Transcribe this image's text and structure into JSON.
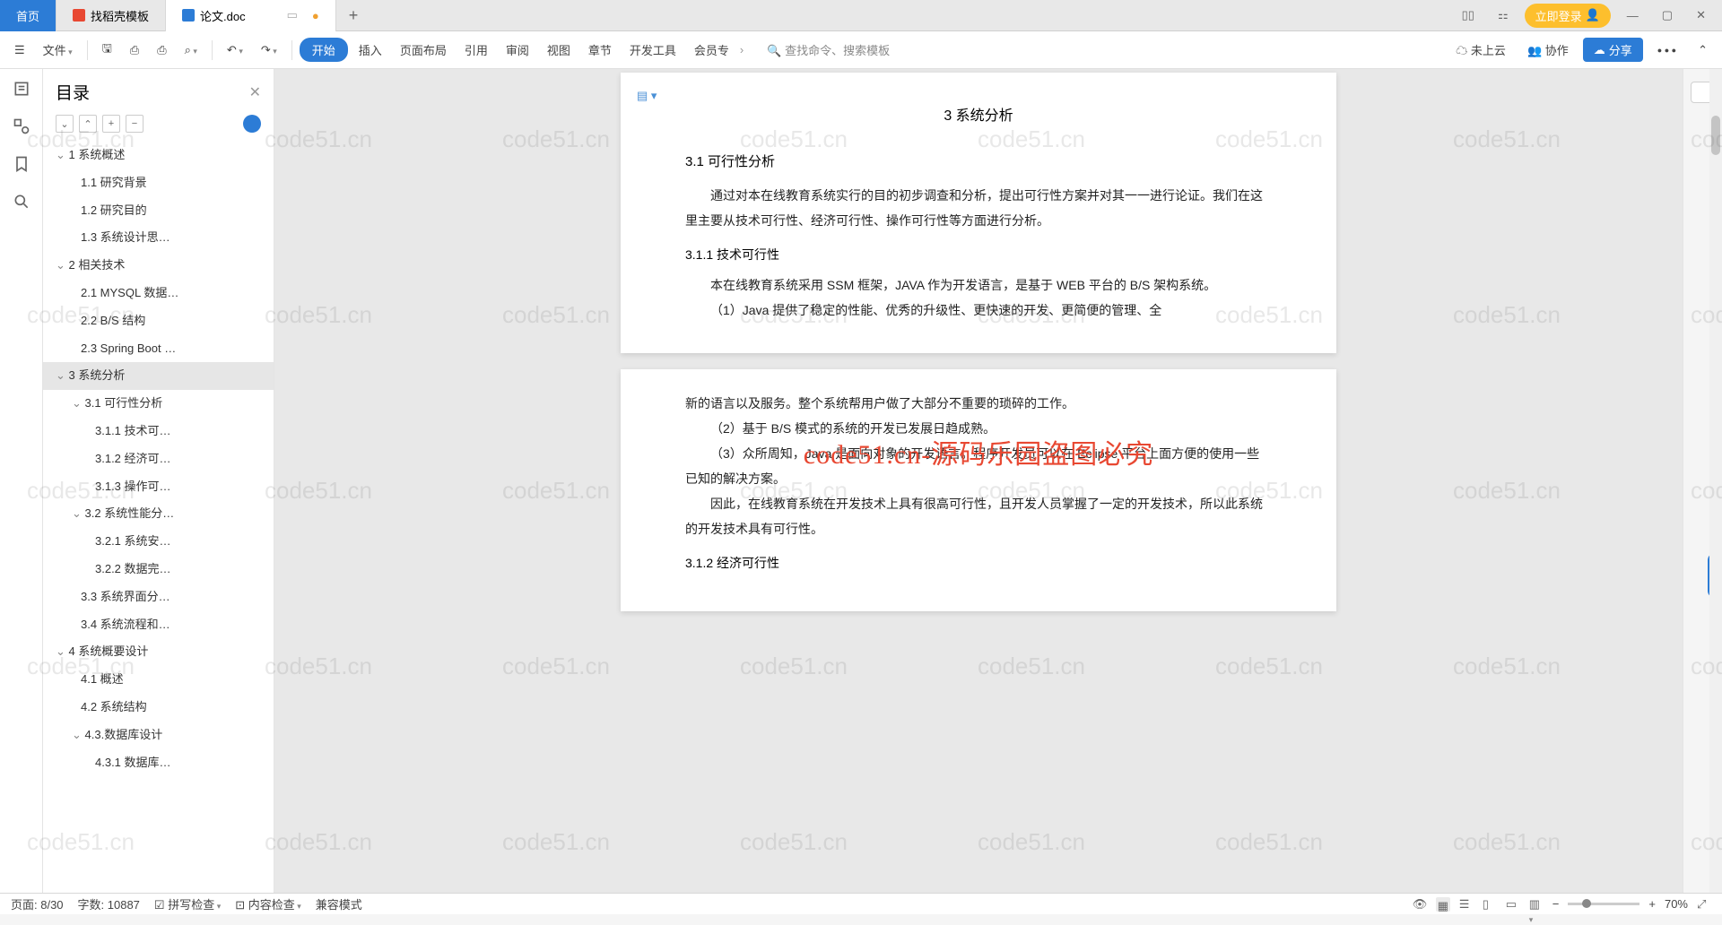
{
  "tabs": {
    "home": "首页",
    "template": "找稻壳模板",
    "doc": "论文.doc"
  },
  "titlebar": {
    "login": "立即登录"
  },
  "ribbon": {
    "menu": "文件",
    "start": "开始",
    "insert": "插入",
    "layout": "页面布局",
    "ref": "引用",
    "review": "审阅",
    "view": "视图",
    "chapter": "章节",
    "devtools": "开发工具",
    "member": "会员专",
    "search_ph": "查找命令、搜索模板",
    "cloud": "未上云",
    "collab": "协作",
    "share": "分享"
  },
  "outline": {
    "title": "目录",
    "items": [
      {
        "t": "1 系统概述",
        "c": "l1"
      },
      {
        "t": "1.1 研究背景",
        "c": "l2"
      },
      {
        "t": "1.2 研究目的",
        "c": "l2"
      },
      {
        "t": "1.3 系统设计思…",
        "c": "l2"
      },
      {
        "t": "2 相关技术",
        "c": "l1"
      },
      {
        "t": "2.1 MYSQL 数据…",
        "c": "l2"
      },
      {
        "t": "2.2 B/S 结构",
        "c": "l2"
      },
      {
        "t": "2.3 Spring Boot …",
        "c": "l2"
      },
      {
        "t": "3 系统分析",
        "c": "l1 sel"
      },
      {
        "t": "3.1 可行性分析",
        "c": "l2s"
      },
      {
        "t": "3.1.1 技术可…",
        "c": "l3"
      },
      {
        "t": "3.1.2 经济可…",
        "c": "l3"
      },
      {
        "t": "3.1.3 操作可…",
        "c": "l3"
      },
      {
        "t": "3.2 系统性能分…",
        "c": "l2s"
      },
      {
        "t": "3.2.1 系统安…",
        "c": "l3"
      },
      {
        "t": "3.2.2 数据完…",
        "c": "l3"
      },
      {
        "t": "3.3 系统界面分…",
        "c": "l2"
      },
      {
        "t": "3.4 系统流程和…",
        "c": "l2"
      },
      {
        "t": "4 系统概要设计",
        "c": "l1"
      },
      {
        "t": "4.1 概述",
        "c": "l2"
      },
      {
        "t": "4.2 系统结构",
        "c": "l2"
      },
      {
        "t": "4.3.数据库设计",
        "c": "l2s"
      },
      {
        "t": "4.3.1 数据库…",
        "c": "l3"
      }
    ]
  },
  "doc": {
    "chapter": "3 系统分析",
    "h31": "3.1 可行性分析",
    "p1": "通过对本在线教育系统实行的目的初步调查和分析，提出可行性方案并对其一一进行论证。我们在这里主要从技术可行性、经济可行性、操作可行性等方面进行分析。",
    "h311": "3.1.1 技术可行性",
    "p2": "本在线教育系统采用 SSM 框架，JAVA 作为开发语言，是基于 WEB 平台的 B/S 架构系统。",
    "p3": "（1）Java 提供了稳定的性能、优秀的升级性、更快速的开发、更简便的管理、全",
    "p4": "新的语言以及服务。整个系统帮用户做了大部分不重要的琐碎的工作。",
    "p5": "（2）基于 B/S 模式的系统的开发已发展日趋成熟。",
    "p6": "（3）众所周知，Java 是面向对象的开发语言。程序开发员可以在 Eclipse 平台上面方便的使用一些已知的解决方案。",
    "p7": "因此，在线教育系统在开发技术上具有很高可行性，且开发人员掌握了一定的开发技术，所以此系统的开发技术具有可行性。",
    "h312": "3.1.2 经济可行性"
  },
  "watermark_text": "code51.cn",
  "center_watermark": "code51.cn-源码乐园盗图必究",
  "status": {
    "page": "页面: 8/30",
    "words": "字数: 10887",
    "spell": "拼写检查",
    "content": "内容检查",
    "compat": "兼容模式",
    "zoom": "70%"
  }
}
